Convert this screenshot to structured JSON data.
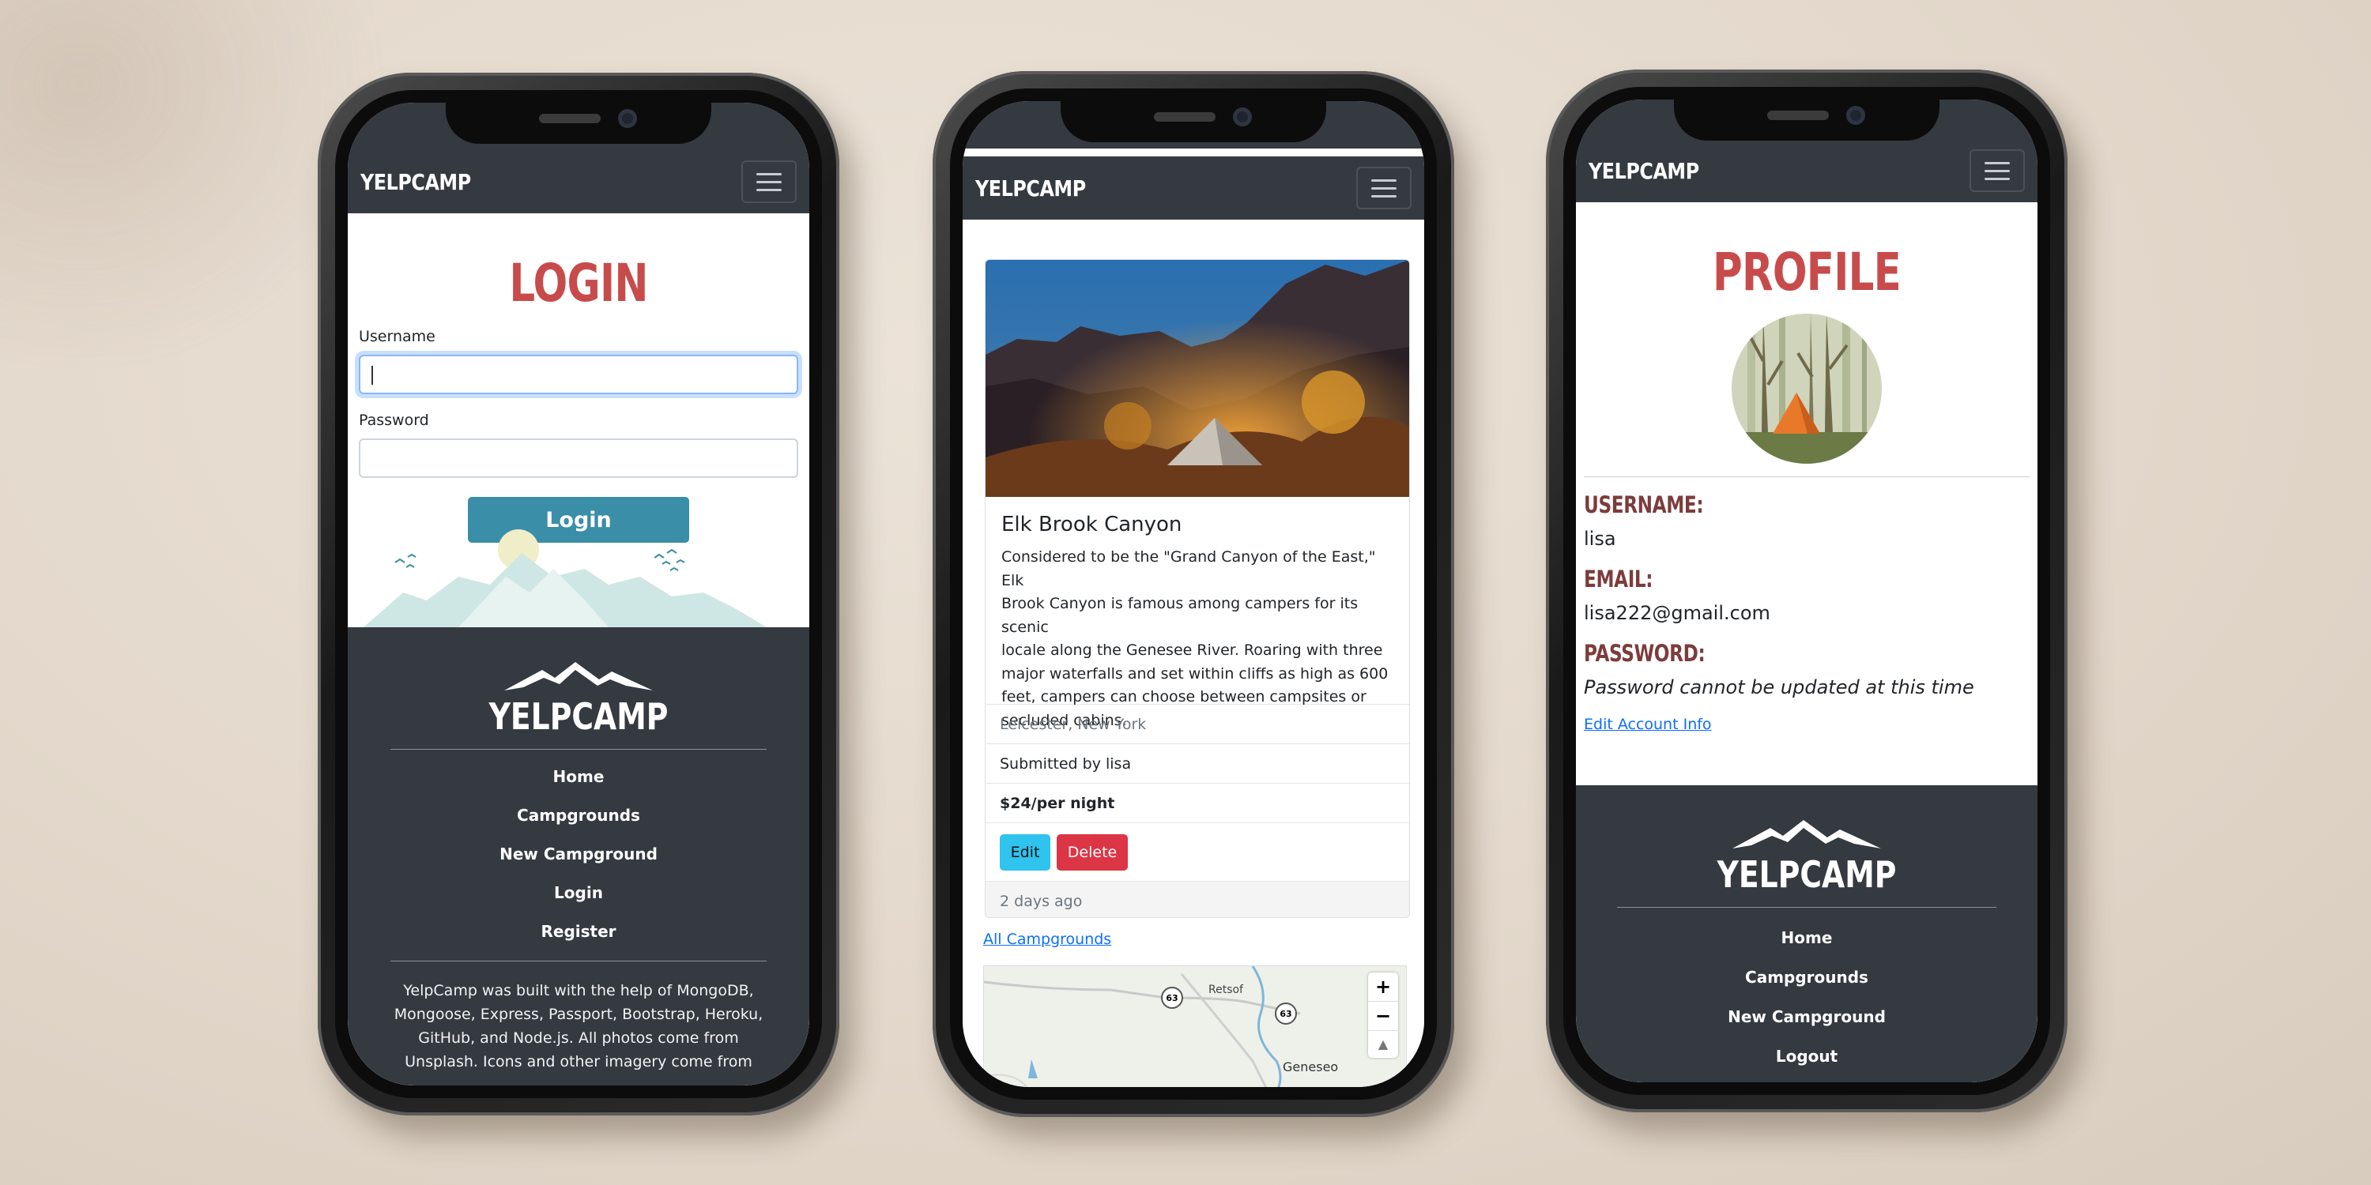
{
  "brand": "YELPCAMP",
  "colors": {
    "navbar": "#343a40",
    "heading_red": "#c84b4b",
    "label_brown": "#7d3c3c",
    "login_button": "#3a8ea8",
    "edit_button": "#2fc3ee",
    "delete_button": "#dc3545",
    "link": "#0d6efd"
  },
  "phone1": {
    "title": "LOGIN",
    "username_label": "Username",
    "username_value": "",
    "password_label": "Password",
    "password_value": "",
    "login_button": "Login",
    "footer_links": [
      "Home",
      "Campgrounds",
      "New Campground",
      "Login",
      "Register"
    ],
    "footer_text_lines": [
      "YelpCamp was built with the help of MongoDB,",
      "Mongoose, Express, Passport, Bootstrap, Heroku,",
      "GitHub, and Node.js. All photos come from",
      "Unsplash. Icons and other imagery come from"
    ]
  },
  "phone2": {
    "camp_title": "Elk Brook Canyon",
    "description_lines": [
      "Considered to be the \"Grand Canyon of the East,\" Elk",
      "Brook Canyon is famous among campers for its scenic",
      "locale along the Genesee River. Roaring with three",
      "major waterfalls and set within cliffs as high as 600",
      "feet, campers can choose between campsites or",
      "secluded cabins."
    ],
    "location": "Leicester, New York",
    "submitted_by": "Submitted by lisa",
    "price": "$24/per night",
    "edit_button": "Edit",
    "delete_button": "Delete",
    "time_ago": "2 days ago",
    "all_campgrounds_link": "All Campgrounds",
    "map": {
      "labels": [
        "Retsof",
        "Geneseo"
      ],
      "route_markers": [
        "63",
        "63"
      ],
      "zoom_in": "+",
      "zoom_out": "−"
    }
  },
  "phone3": {
    "title": "PROFILE",
    "username_label": "USERNAME:",
    "username_value": "lisa",
    "email_label": "EMAIL:",
    "email_value": "lisa222@gmail.com",
    "password_label": "PASSWORD:",
    "password_value": "Password cannot be updated at this time",
    "edit_link": "Edit Account Info",
    "footer_links": [
      "Home",
      "Campgrounds",
      "New Campground",
      "Logout"
    ]
  }
}
